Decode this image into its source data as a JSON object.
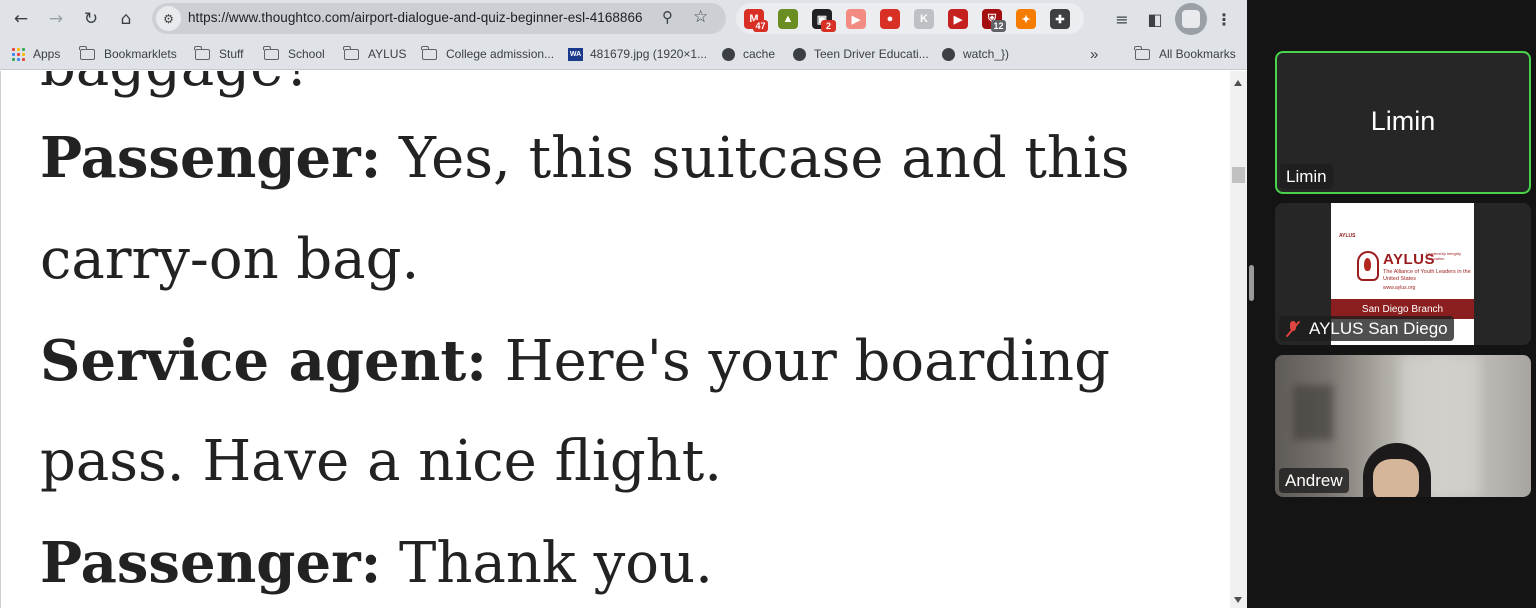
{
  "browser": {
    "url": "https://www.thoughtco.com/airport-dialogue-and-quiz-beginner-esl-4168866",
    "extensions": [
      {
        "icon": "gmail-icon",
        "badge": "47",
        "color": "#d93025",
        "badge_color": "#d93025"
      },
      {
        "icon": "potted-plant-icon",
        "badge": "",
        "color": "#6b8e23",
        "badge_color": ""
      },
      {
        "icon": "tab-counter-icon",
        "badge": "2",
        "color": "#202124",
        "badge_color": "#d93025"
      },
      {
        "icon": "video-speed-icon",
        "badge": "",
        "color": "#f28b82",
        "badge_color": ""
      },
      {
        "icon": "timer-icon",
        "badge": "",
        "color": "#d93025",
        "badge_color": ""
      },
      {
        "icon": "text-extension-icon",
        "badge": "",
        "color": "#bdc1c6",
        "badge_color": ""
      },
      {
        "icon": "play-circle-icon",
        "badge": "",
        "color": "#c5221f",
        "badge_color": ""
      },
      {
        "icon": "shield-block-icon",
        "badge": "12",
        "color": "#a50e0e",
        "badge_color": "#5f6368"
      },
      {
        "icon": "orange-tools-icon",
        "badge": "",
        "color": "#f57c00",
        "badge_color": ""
      },
      {
        "icon": "puzzle-piece-icon",
        "badge": "",
        "color": "#3c4043",
        "badge_color": ""
      }
    ],
    "bookmarks": [
      {
        "label": "Apps",
        "icon": "apps-grid-icon"
      },
      {
        "label": "Bookmarklets",
        "icon": "folder-icon"
      },
      {
        "label": "Stuff",
        "icon": "folder-icon"
      },
      {
        "label": "School",
        "icon": "folder-icon"
      },
      {
        "label": "AYLUS",
        "icon": "folder-icon"
      },
      {
        "label": "College admission...",
        "icon": "folder-icon"
      },
      {
        "label": "481679.jpg (1920×1...",
        "icon": "wa-image-icon"
      },
      {
        "label": "cache",
        "icon": "globe-icon"
      },
      {
        "label": "Teen Driver Educati...",
        "icon": "globe-icon"
      },
      {
        "label": "watch_})",
        "icon": "globe-icon"
      }
    ],
    "overflow_label": "»",
    "all_bookmarks": "All Bookmarks"
  },
  "article": {
    "partial_line": "baggage?",
    "lines": [
      {
        "speaker": "Passenger:",
        "text": " Yes, this suitcase and this"
      },
      {
        "speaker": "",
        "text": "carry-on bag."
      },
      {
        "speaker": "Service agent:",
        "text": " Here's your boarding"
      },
      {
        "speaker": "",
        "text": "pass. Have a nice flight."
      },
      {
        "speaker": "Passenger:",
        "text": " Thank you."
      }
    ]
  },
  "meeting": {
    "participants": [
      {
        "name": "Limin",
        "display": "Limin",
        "active_speaker": true,
        "muted": false
      },
      {
        "name": "AYLUS San Diego",
        "muted": true,
        "shared_card": {
          "small_logo": "AYLUS",
          "org": "AYLUS",
          "org_tag": "Leadership Integrity Innovation",
          "tagline": "The Alliance of Youth Leaders in the United States",
          "web": "www.aylus.org",
          "banner": "San Diego Branch"
        }
      },
      {
        "name": "Andrew",
        "muted": false
      }
    ]
  },
  "colors": {
    "active_speaker_border": "#4ad34a",
    "muted_icon": "#e0453f",
    "aylus_red": "#8b1e1e"
  }
}
